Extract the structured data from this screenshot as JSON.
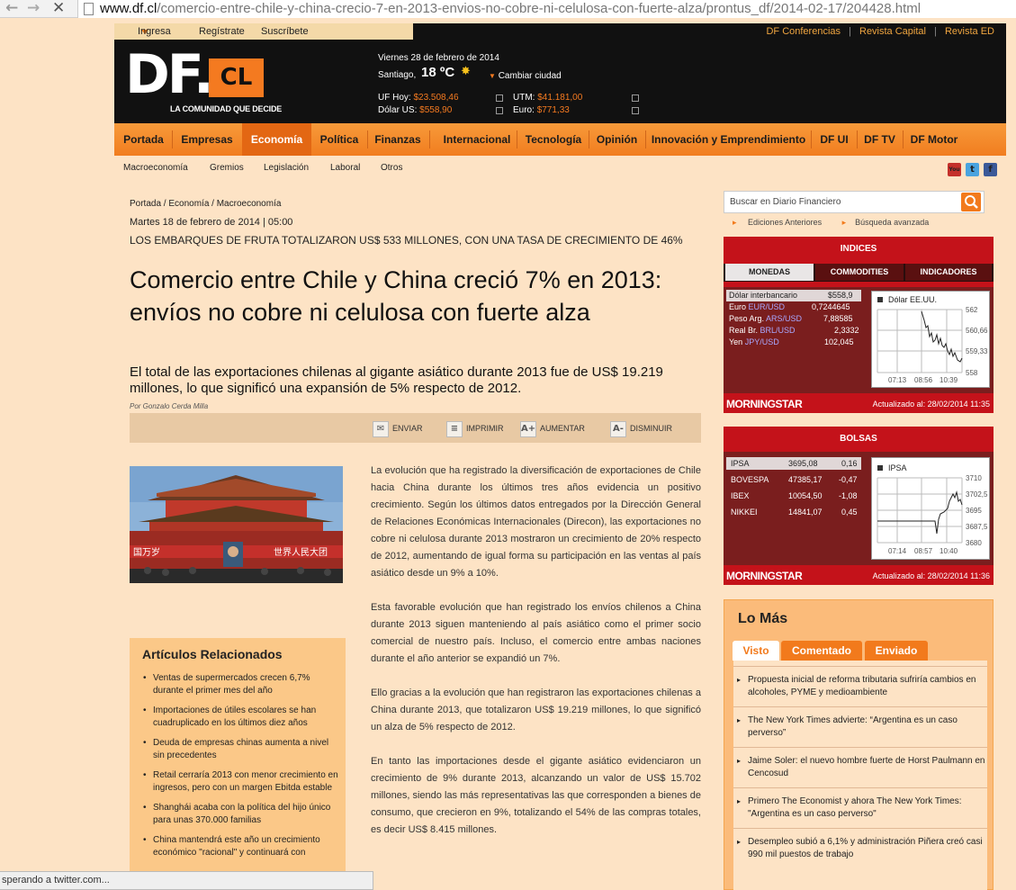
{
  "browser": {
    "url_domain": "www.df.cl",
    "url_path": "/comercio-entre-chile-y-china-crecio-7-en-2013-envios-no-cobre-ni-celulosa-con-fuerte-alza/prontus_df/2014-02-17/204428.html",
    "status": "sperando a twitter.com..."
  },
  "topbar": {
    "ingresa": "Ingresa",
    "registrate": "Regístrate",
    "suscribete": "Suscríbete",
    "conferencias": "DF Conferencias",
    "revista_capital": "Revista Capital",
    "revista_ed": "Revista ED",
    "sep": "|"
  },
  "logo": {
    "df": "DF.",
    "cl": "CL",
    "tagline": "LA COMUNIDAD QUE DECIDE"
  },
  "header": {
    "date": "Viernes 28 de febrero de 2014",
    "city": "Santiago,",
    "temp": "18 ºC",
    "change_city": "Cambiar ciudad",
    "uf_label": "UF Hoy:",
    "uf_value": "$23.508,46",
    "utm_label": "UTM:",
    "utm_value": "$41.181,00",
    "dolar_label": "Dólar US:",
    "dolar_value": "$558,90",
    "euro_label": "Euro:",
    "euro_value": "$771,33"
  },
  "nav": {
    "items": [
      "Portada",
      "Empresas",
      "Economía",
      "Política",
      "Finanzas",
      "Internacional",
      "Tecnología",
      "Opinión",
      "Innovación y Emprendimiento",
      "DF UI",
      "DF TV",
      "DF Motor"
    ],
    "sub": [
      "Macroeconomía",
      "Gremios",
      "Legislación",
      "Laboral",
      "Otros"
    ]
  },
  "social": {
    "youtube": "You",
    "twitter": "t",
    "facebook": "f"
  },
  "article": {
    "breadcrumb": "Portada / Economía / Macroeconomía",
    "date": "Martes 18 de febrero de 2014 | 05:00",
    "kicker": "LOS EMBARQUES DE FRUTA TOTALIZARON US$ 533 MILLONES, CON UNA TASA DE CRECIMIENTO DE 46%",
    "title": "Comercio entre Chile y China creció 7% en 2013: envíos no cobre ni celulosa con fuerte alza",
    "lead": "El total de las exportaciones chilenas al gigante asiático durante 2013 fue de US$ 19.219 millones, lo que significó una expansión de 5% respecto de 2012.",
    "byline": "Por Gonzalo Cerda Milla",
    "tools": {
      "enviar": "ENVIAR",
      "imprimir": "IMPRIMIR",
      "aumentar": "AUMENTAR",
      "disminuir": "DISMINUIR",
      "a_plus": "A+",
      "a_minus": "A-"
    },
    "photo_sign_left": "国万岁",
    "photo_sign_right": "世界人民大团",
    "paragraphs": [
      "La evolución que ha registrado la diversificación de exportaciones de Chile hacia China durante los últimos tres años evidencia un positivo crecimiento. Según los últimos datos entregados por la Dirección General de Relaciones Económicas Internacionales (Direcon), las exportaciones no cobre ni celulosa durante 2013 mostraron un crecimiento de 20% respecto de 2012, aumentando de igual forma su participación en las ventas al país asiático desde un 9% a 10%.",
      "Esta favorable evolución que han registrado los envíos chilenos a China durante 2013 siguen manteniendo al país asiático como el primer socio comercial de nuestro país. Incluso, el comercio entre ambas naciones durante el año anterior se expandió un 7%.",
      "Ello gracias a la evolución que han registraron las exportaciones chilenas a China durante 2013, que totalizaron US$ 19.219 millones, lo que significó un alza de 5% respecto de 2012.",
      "En tanto las importaciones desde el gigante asiático evidenciaron un crecimiento de 9% durante 2013, alcanzando un valor de US$ 15.702 millones, siendo las más representativas las que corresponden a bienes de consumo, que crecieron en 9%, totalizando el 54% de las compras totales, es decir US$ 8.415 millones."
    ]
  },
  "related": {
    "title": "Artículos Relacionados",
    "items": [
      "Ventas de supermercados crecen 6,7% durante el primer mes del año",
      "Importaciones de útiles escolares se han cuadruplicado en los últimos diez años",
      "Deuda de empresas chinas aumenta a nivel sin precedentes",
      "Retail cerraría 2013 con menor crecimiento en ingresos, pero con un margen Ebitda estable",
      "Shanghái acaba con la política del hijo único para unas 370.000 familias",
      "China mantendrá este año un crecimiento económico \"racional\" y continuará con"
    ]
  },
  "search": {
    "placeholder": "Buscar en Diario Financiero",
    "anteriores": "Ediciones Anteriores",
    "avanzada": "Búsqueda avanzada"
  },
  "indices": {
    "title": "INDICES",
    "tabs": [
      "MONEDAS",
      "COMMODITIES",
      "INDICADORES"
    ],
    "rows": [
      {
        "name": "Dólar interbancario",
        "pair": "",
        "value": "$558,9"
      },
      {
        "name": "Euro ",
        "pair": "EUR/USD",
        "value": "0,7244645"
      },
      {
        "name": "Peso Arg. ",
        "pair": "ARS/USD",
        "value": "7,88585"
      },
      {
        "name": "Real Br. ",
        "pair": "BRL/USD",
        "value": "2,3332"
      },
      {
        "name": "Yen ",
        "pair": "JPY/USD",
        "value": "102,045"
      }
    ],
    "chart_title": "Dólar EE.UU.",
    "chart_y": [
      "562",
      "560,66",
      "559,33",
      "558"
    ],
    "chart_x": [
      "07:13",
      "08:56",
      "10:39"
    ],
    "brand": "MORNINGSTAR",
    "updated": "Actualizado al: 28/02/2014 11:35"
  },
  "bolsas": {
    "title": "BOLSAS",
    "rows": [
      {
        "name": "IPSA",
        "value": "3695,08",
        "change": "0,16"
      },
      {
        "name": "BOVESPA",
        "value": "47385,17",
        "change": "-0,47"
      },
      {
        "name": "IBEX",
        "value": "10054,50",
        "change": "-1,08"
      },
      {
        "name": "NIKKEI",
        "value": "14841,07",
        "change": "0,45"
      }
    ],
    "chart_title": "IPSA",
    "chart_y": [
      "3710",
      "3702,5",
      "3695",
      "3687,5",
      "3680"
    ],
    "chart_x": [
      "07:14",
      "08:57",
      "10:40"
    ],
    "brand": "MORNINGSTAR",
    "updated": "Actualizado al: 28/02/2014 11:36"
  },
  "lomas": {
    "title": "Lo Más",
    "tabs": [
      "Visto",
      "Comentado",
      "Enviado"
    ],
    "items": [
      "Propuesta inicial de reforma tributaria sufriría cambios en alcoholes, PYME y medioambiente",
      "The New York Times advierte: “Argentina es un caso perverso”",
      "Jaime Soler: el nuevo hombre fuerte de Horst Paulmann en Cencosud",
      "Primero The Economist y ahora The New York Times: \"Argentina es un caso perverso\"",
      "Desempleo subió a 6,1% y administración Piñera creó casi 990 mil puestos de trabajo"
    ]
  },
  "colors": {
    "accent": "#f27a1c",
    "red": "#c4121a",
    "page": "#fde3c5"
  }
}
